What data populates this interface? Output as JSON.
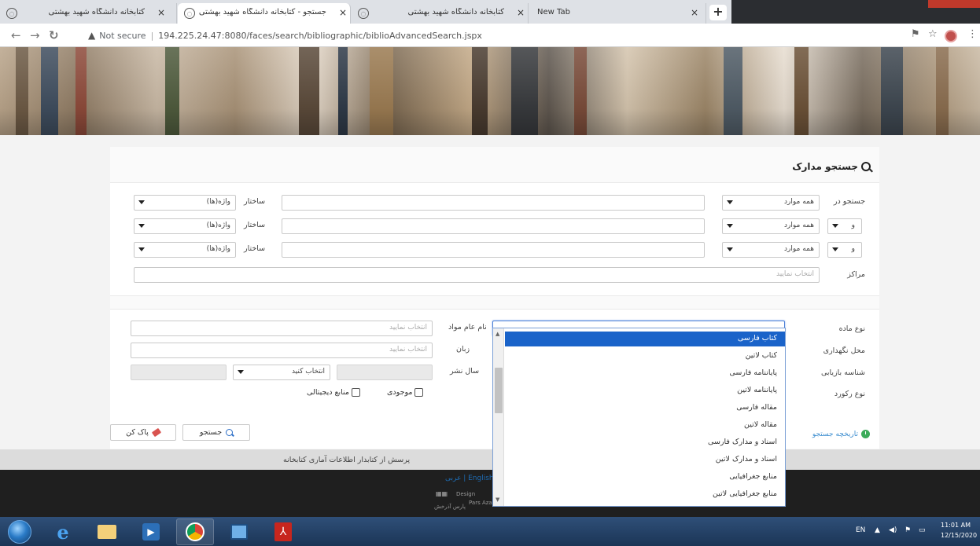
{
  "browser": {
    "tabs": [
      {
        "title": "کتابخانه دانشگاه شهید بهشتی"
      },
      {
        "title": "جستجو - کتابخانه دانشگاه شهید بهشتی"
      },
      {
        "title": "کتابخانه دانشگاه شهید بهشتی"
      },
      {
        "title": "New Tab"
      }
    ],
    "address": {
      "security_label": "Not secure",
      "url": "194.225.24.47:8080/faces/search/bibliographic/biblioAdvancedSearch.jspx"
    }
  },
  "page": {
    "title": "جستجو مدارک",
    "search_rows": [
      {
        "prefix_label": "جستجو در",
        "field_value": "همه موارد",
        "term_value": "",
        "structure_label": "ساختار",
        "structure_value": "واژه(ها)"
      },
      {
        "prefix_label": "و",
        "field_value": "همه موارد",
        "term_value": "",
        "structure_label": "ساختار",
        "structure_value": "واژه(ها)"
      },
      {
        "prefix_label": "و",
        "field_value": "همه موارد",
        "term_value": "",
        "structure_label": "ساختار",
        "structure_value": "واژه(ها)"
      }
    ],
    "centers": {
      "label": "مراکز",
      "placeholder": "انتخاب نمایید"
    },
    "filters": {
      "material_type_label": "نوع ماده",
      "location_label": "محل نگهداری",
      "retrieval_label": "شناسه بازیابی",
      "record_type_label": "نوع رکورد",
      "general_material_label": "نام عام مواد",
      "general_material_placeholder": "انتخاب نمایید",
      "language_label": "زبان",
      "language_placeholder": "انتخاب نمایید",
      "pub_year_label": "سال نشر",
      "pub_year_select": "انتخاب کنید",
      "available_label": "موجودی",
      "digital_label": "منابع دیجیتالی"
    },
    "buttons": {
      "search": "جستجو",
      "clear": "پاک کن"
    },
    "history_link": "تاریخچه جستجو",
    "dropdown_options": [
      "کتاب فارسی",
      "کتاب لاتین",
      "پایاننامه فارسی",
      "پایاننامه لاتین",
      "مقاله فارسی",
      "مقاله لاتین",
      "اسناد و مدارک فارسی",
      "اسناد و مدارک لاتین",
      "منابع جغرافیایی",
      "منابع جغرافیایی لاتین"
    ],
    "dropdown_selected_index": 0
  },
  "footer": {
    "links": "پرسش از کتابدار    اطلاعات آماری کتابخانه",
    "language_links": "English | عربی",
    "design_credit": "Design",
    "company": "Pars Azarakhsh Co.",
    "logo_text": "پارس آذرخش"
  },
  "taskbar": {
    "language": "EN",
    "time": "11:01 AM",
    "date": "12/15/2020"
  },
  "colors": {
    "accent": "#1a63c9",
    "history_icon": "#3cab5a",
    "link": "#3a8ccf"
  }
}
